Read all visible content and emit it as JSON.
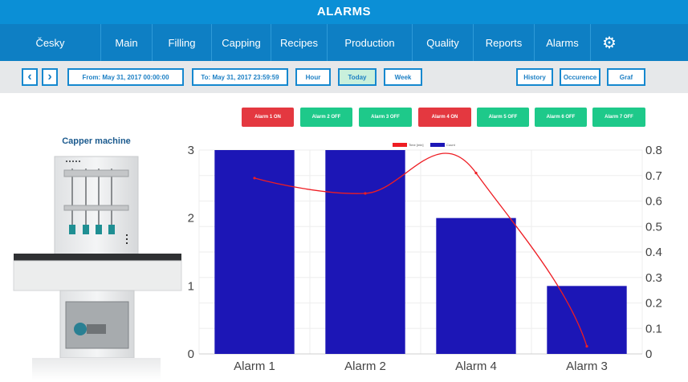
{
  "title": "ALARMS",
  "nav": {
    "items": [
      "Česky",
      "Main",
      "Filling",
      "Capping",
      "Recipes",
      "Production",
      "Quality",
      "Reports",
      "Alarms"
    ],
    "settings_icon": "gear-icon"
  },
  "toolbar": {
    "prev_icon": "chevron-left-icon",
    "next_icon": "chevron-right-icon",
    "from": "From: May 31, 2017 00:00:00",
    "to": "To: May 31, 2017 23:59:59",
    "hour": "Hour",
    "today": "Today",
    "week": "Week",
    "history": "History",
    "occurence": "Occurence",
    "graf": "Graf"
  },
  "alarm_buttons": [
    {
      "label": "Alarm 1 ON",
      "state": "on"
    },
    {
      "label": "Alarm 2 OFF",
      "state": "off"
    },
    {
      "label": "Alarm 3 OFF",
      "state": "off"
    },
    {
      "label": "Alarm 4 ON",
      "state": "on"
    },
    {
      "label": "Alarm 5 OFF",
      "state": "off"
    },
    {
      "label": "Alarm 6 OFF",
      "state": "off"
    },
    {
      "label": "Alarm 7 OFF",
      "state": "off"
    }
  ],
  "machine": {
    "title": "Capper machine"
  },
  "colors": {
    "title_bar": "#0b8fd6",
    "nav_bar": "#0e7fc4",
    "alarm_on": "#e43840",
    "alarm_off": "#1ec98a",
    "bar": "#1c16b6",
    "line": "#ee1d23"
  },
  "chart_data": {
    "type": "bar",
    "categories": [
      "Alarm 1",
      "Alarm 2",
      "Alarm 4",
      "Alarm 3"
    ],
    "series": [
      {
        "name": "Count",
        "type": "bar",
        "axis": "left",
        "values": [
          3,
          3,
          2,
          1
        ]
      },
      {
        "name": "Time [min]",
        "type": "line",
        "axis": "right",
        "values": [
          0.69,
          0.63,
          0.71,
          0.03
        ]
      }
    ],
    "ylim_left": [
      0,
      3
    ],
    "ylim_right": [
      0,
      0.8
    ],
    "yticks_left": [
      "0",
      "1",
      "2",
      "3"
    ],
    "yticks_right": [
      "0",
      "0.1",
      "0.2",
      "0.3",
      "0.4",
      "0.5",
      "0.6",
      "0.7",
      "0.8"
    ],
    "legend": "top-center",
    "grid": true
  }
}
